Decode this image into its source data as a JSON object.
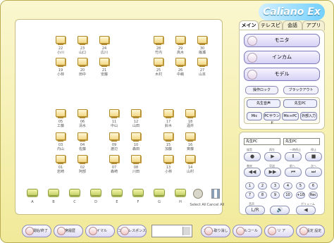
{
  "brand": "Caliano Ex",
  "tabs": [
    "メイン",
    "テレスピナ",
    "会話",
    "アプリ"
  ],
  "seats": [
    [
      "22",
      "小川"
    ],
    [
      "23",
      "山口"
    ],
    [
      "24",
      "広川"
    ],
    [
      "28",
      "竹内"
    ],
    [
      "29",
      "高木"
    ],
    [
      "30",
      "篠瀬"
    ],
    [
      "19",
      "小林"
    ],
    [
      "20",
      "田中"
    ],
    [
      "21",
      "安藤"
    ],
    [
      "25",
      "木村"
    ],
    [
      "26",
      "中嶋"
    ],
    [
      "27",
      "山本"
    ],
    [
      "05",
      "工藤"
    ],
    [
      "06",
      "清水"
    ],
    [
      "11",
      "中山"
    ],
    [
      "12",
      "山田"
    ],
    [
      "17",
      "鈴木"
    ],
    [
      "18",
      "酒井"
    ],
    [
      "03",
      "内山"
    ],
    [
      "04",
      "佐藤"
    ],
    [
      "09",
      "渡辺"
    ],
    [
      "10",
      "森田"
    ],
    [
      "15",
      "加藤"
    ],
    [
      "16",
      "斉藤"
    ],
    [
      "01",
      "岩崎"
    ],
    [
      "02",
      "阿部"
    ],
    [
      "07",
      "森崎"
    ],
    [
      "08",
      "川田"
    ],
    [
      "13",
      "小林"
    ],
    [
      "14",
      "山村"
    ]
  ],
  "groups": [
    "A",
    "B",
    "C",
    "D",
    "E",
    "F",
    "G",
    "H",
    "Select All",
    "Cancel All"
  ],
  "panel": {
    "monitor": "モニタ",
    "intercom": "インカム",
    "model": "モデル",
    "small1": "操作ロック",
    "small2": "ブラックアウト",
    "teacherAudio": "先生音声",
    "teacherPC": "先生PC",
    "mic": "Mic",
    "pcSound": "PCサウンド",
    "micPc": "Mic+PC",
    "external": "外部入力"
  },
  "control": {
    "select1": "先生PC",
    "select2": "先生PC",
    "labels": [
      "録音",
      "再生",
      "一時停止",
      "停止",
      "巻戻",
      "早送",
      "前へ",
      "次へ"
    ],
    "nums": [
      "1",
      "2",
      "3",
      "4",
      "5",
      "6",
      "7",
      "8",
      "9",
      "10",
      "+10",
      "Rec"
    ],
    "bottomLabels": [
      "音声",
      "",
      "ボリューム"
    ],
    "l_r": "L/R"
  },
  "bottom": {
    "b1": "授業開始/終了",
    "b2": "出席履歴",
    "b3": "サイマル",
    "b4": "コールレスポンス",
    "combo": "",
    "b5": "コール取り消し",
    "b6": "オールコール",
    "b7": "ク リ ア",
    "b8": "実習設定 設定"
  }
}
